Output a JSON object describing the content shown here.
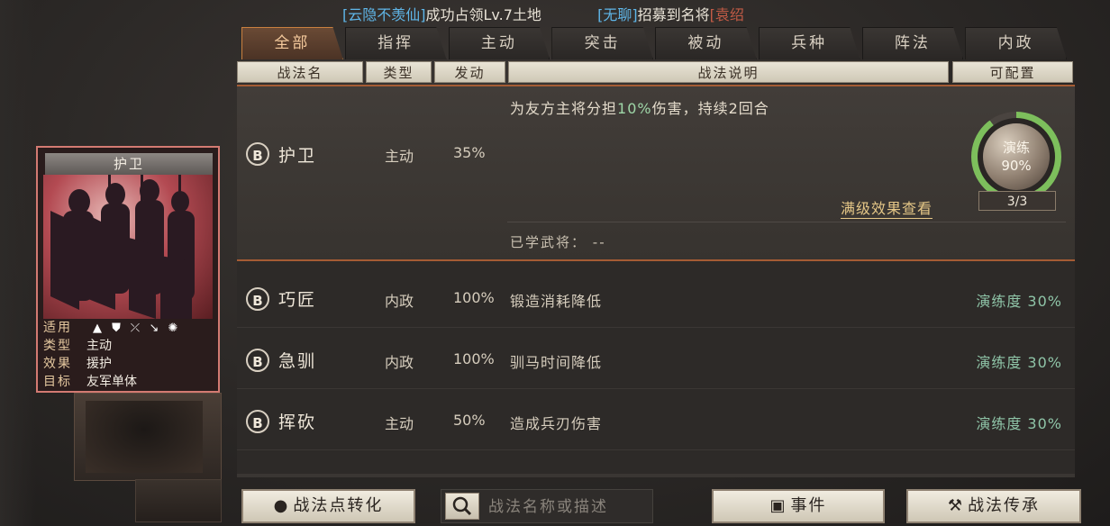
{
  "ticker": {
    "msg1_tag": "[云隐不羡仙]",
    "msg1_text": "成功占领Lv.7土地",
    "msg2_tag": "[无聊]",
    "msg2_text": "招募到名将",
    "msg2_tail": "[袁绍"
  },
  "tabs": [
    "全部",
    "指挥",
    "主动",
    "突击",
    "被动",
    "兵种",
    "阵法",
    "内政"
  ],
  "headers": {
    "name": "战法名",
    "type": "类型",
    "trigger": "发动",
    "desc": "战法说明",
    "assignable": "可配置"
  },
  "selected": {
    "grade": "B",
    "name": "护卫",
    "type": "主动",
    "rate": "35%",
    "desc_pre": "为友方主将分担",
    "desc_hl": "10%",
    "desc_post": "伤害，持续2回合",
    "full_effect": "满级效果查看",
    "learned_label": "已学武将：",
    "learned_value": "--",
    "drill_label": "演练",
    "drill_pct": "90%",
    "drill_progress": 0.9,
    "drill_count": "3/3"
  },
  "rows": [
    {
      "grade": "B",
      "name": "巧匠",
      "type": "内政",
      "rate": "100%",
      "desc": "锻造消耗降低",
      "drill": "演练度 30%"
    },
    {
      "grade": "B",
      "name": "急驯",
      "type": "内政",
      "rate": "100%",
      "desc": "驯马时间降低",
      "drill": "演练度 30%"
    },
    {
      "grade": "B",
      "name": "挥砍",
      "type": "主动",
      "rate": "50%",
      "desc": "造成兵刃伤害",
      "drill": "演练度 30%"
    }
  ],
  "card": {
    "title": "护卫",
    "applies_label": "适用",
    "type_label": "类型",
    "type_value": "主动",
    "effect_label": "效果",
    "effect_value": "援护",
    "target_label": "目标",
    "target_value": "友军单体",
    "unit_icons": [
      "cavalry-icon",
      "shield-icon",
      "bow-icon",
      "spear-icon",
      "chariot-icon"
    ]
  },
  "buttons": {
    "convert": "战法点转化",
    "search_placeholder": "战法名称或描述",
    "events": "事件",
    "inherit": "战法传承"
  },
  "colors": {
    "accent": "#c9803f",
    "highlight": "#9fd7a8",
    "drill": "#8fc5a8",
    "link": "#e5c787"
  }
}
